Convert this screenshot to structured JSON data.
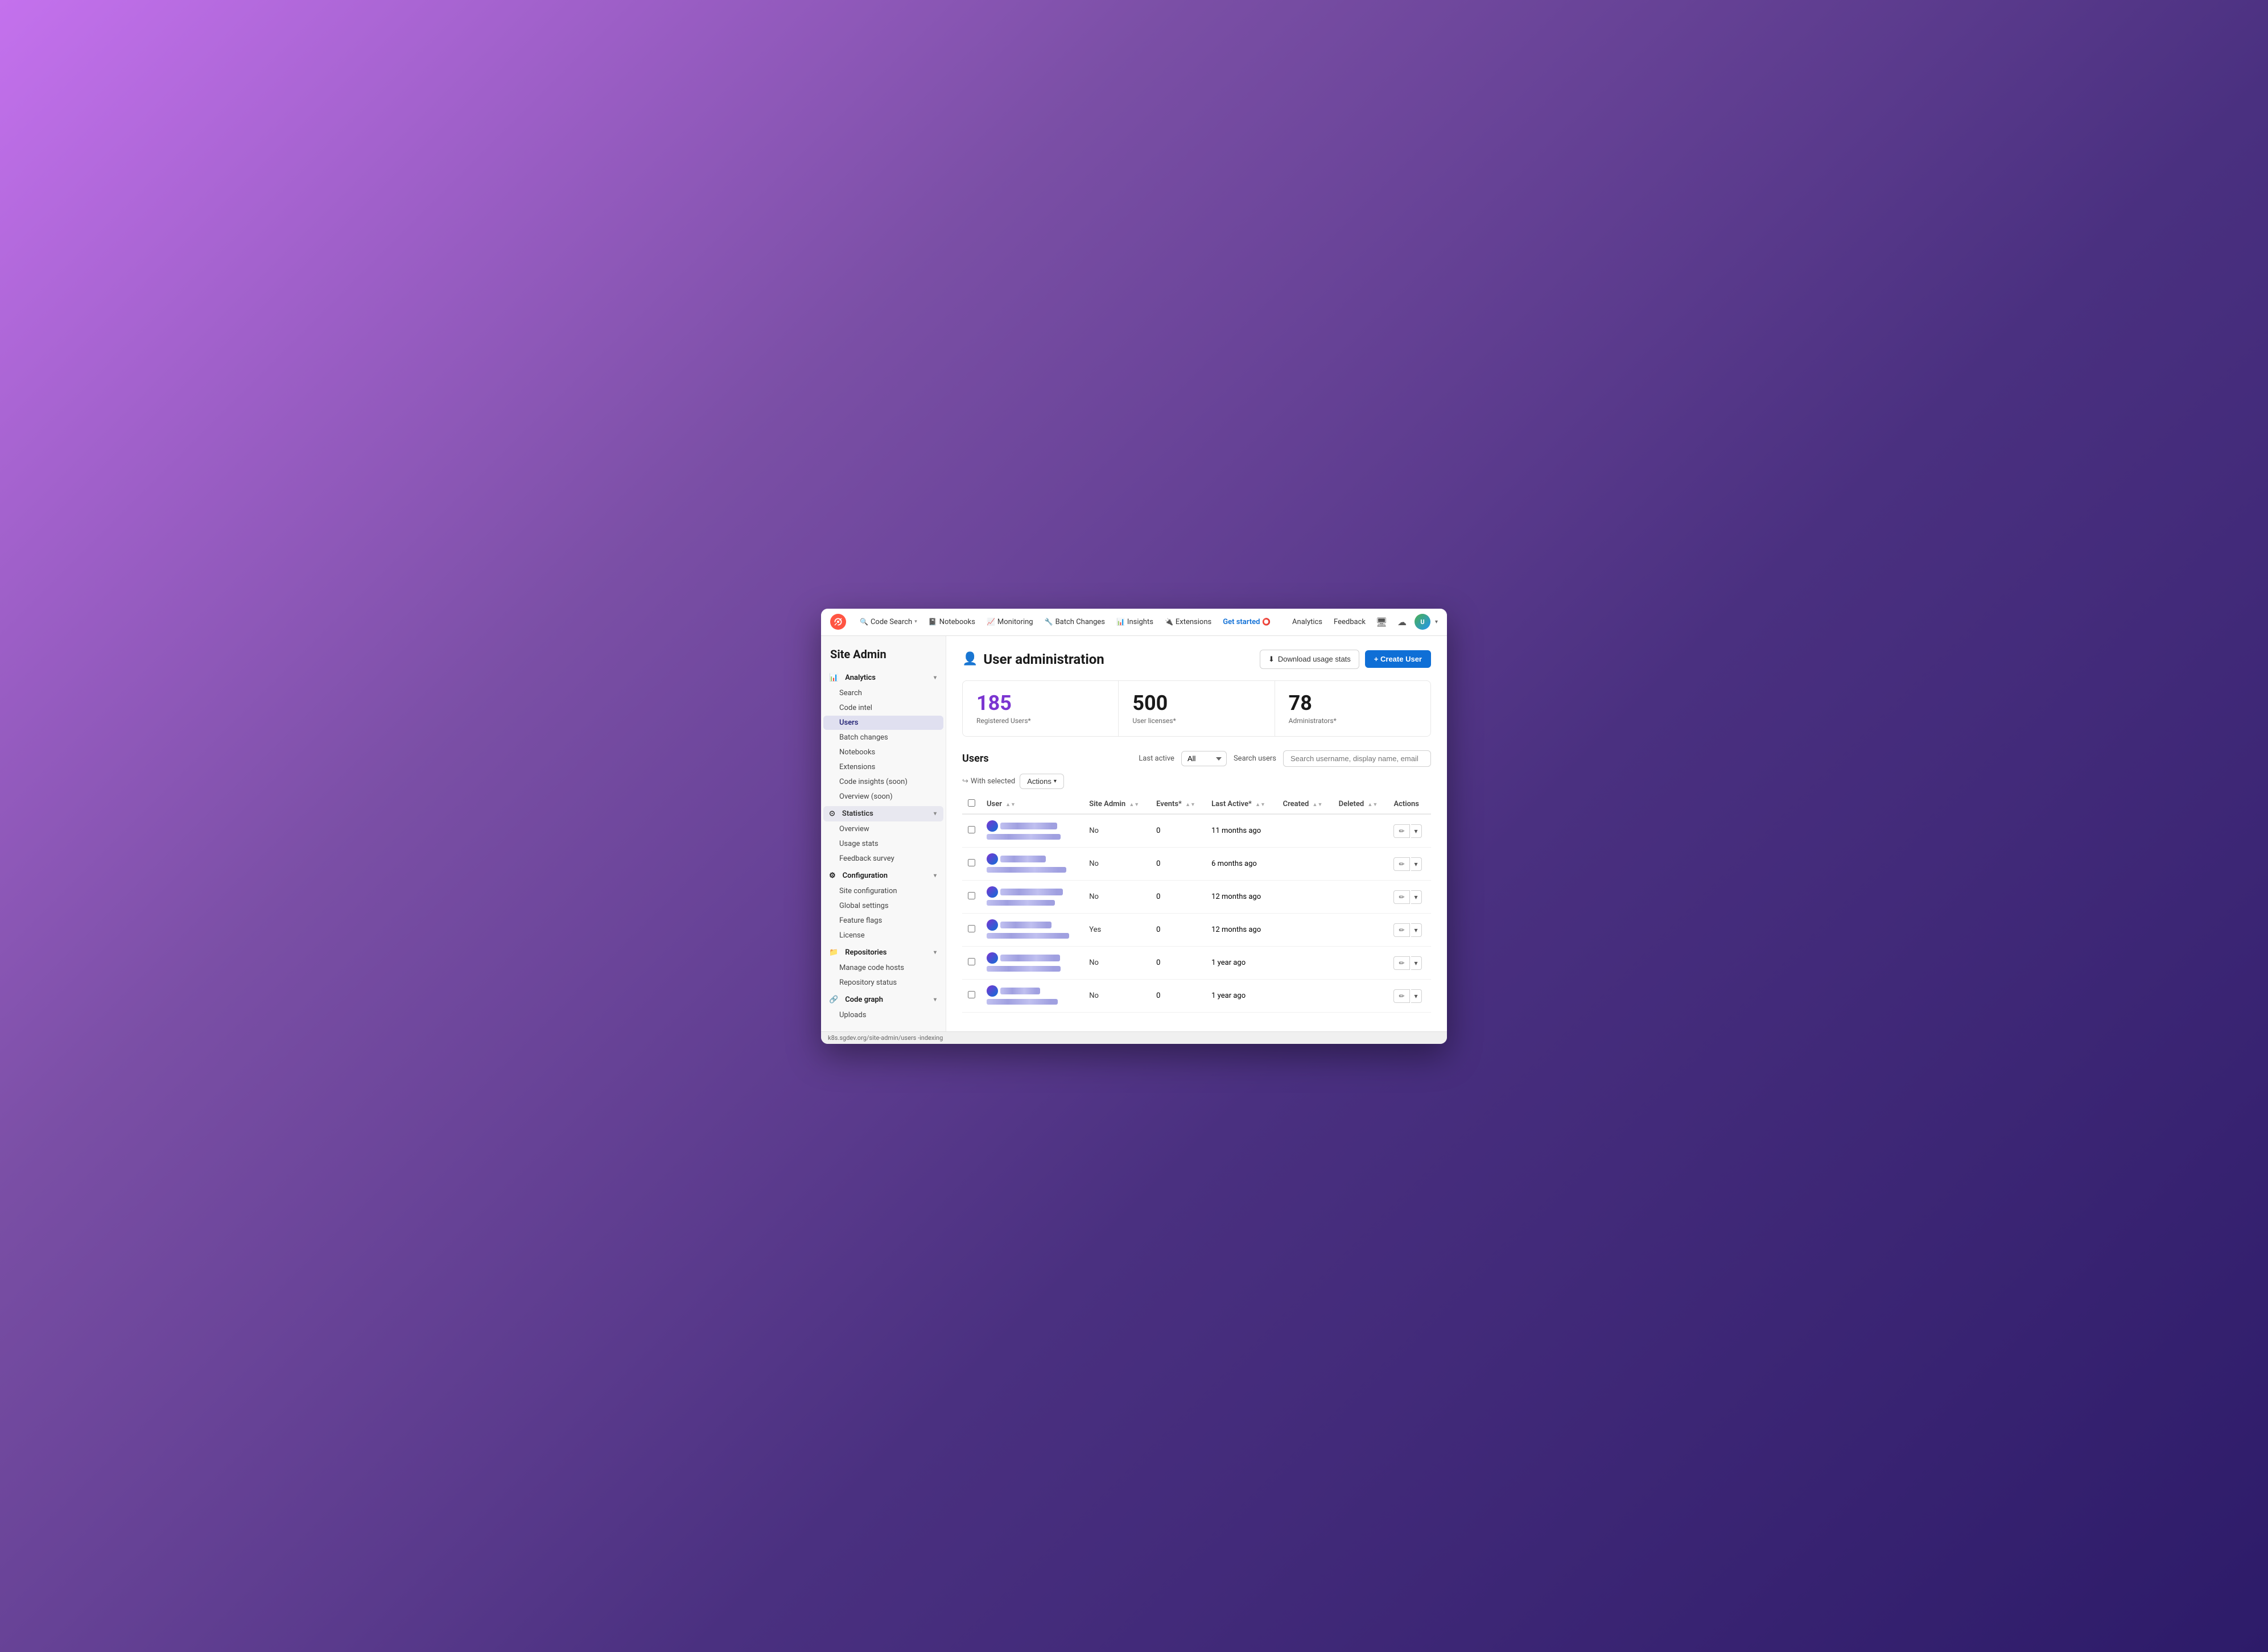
{
  "window": {
    "title": "Site Admin - User Administration"
  },
  "topnav": {
    "logo_label": "Sourcegraph",
    "items": [
      {
        "label": "Code Search",
        "icon": "🔍",
        "has_dropdown": true
      },
      {
        "label": "Notebooks",
        "icon": "📓",
        "has_dropdown": false
      },
      {
        "label": "Monitoring",
        "icon": "📈",
        "has_dropdown": false
      },
      {
        "label": "Batch Changes",
        "icon": "🔧",
        "has_dropdown": false
      },
      {
        "label": "Insights",
        "icon": "📊",
        "has_dropdown": false
      },
      {
        "label": "Extensions",
        "icon": "🔌",
        "has_dropdown": false
      },
      {
        "label": "Get started",
        "icon": "⭕",
        "has_dropdown": false,
        "class": "nav-get-started"
      }
    ],
    "right_items": [
      {
        "label": "Analytics"
      },
      {
        "label": "Feedback"
      }
    ]
  },
  "sidebar": {
    "site_admin_title": "Site Admin",
    "sections": [
      {
        "id": "analytics",
        "label": "Analytics",
        "icon": "📊",
        "active": false,
        "items": [
          {
            "label": "Search"
          },
          {
            "label": "Code intel"
          },
          {
            "label": "Users",
            "active": true
          },
          {
            "label": "Batch changes"
          },
          {
            "label": "Notebooks"
          },
          {
            "label": "Extensions"
          },
          {
            "label": "Code insights (soon)"
          },
          {
            "label": "Overview (soon)"
          }
        ]
      },
      {
        "id": "statistics",
        "label": "Statistics",
        "icon": "📈",
        "active": true,
        "items": [
          {
            "label": "Overview"
          },
          {
            "label": "Usage stats"
          },
          {
            "label": "Feedback survey"
          }
        ]
      },
      {
        "id": "configuration",
        "label": "Configuration",
        "icon": "⚙️",
        "active": false,
        "items": [
          {
            "label": "Site configuration"
          },
          {
            "label": "Global settings"
          },
          {
            "label": "Feature flags"
          },
          {
            "label": "License"
          }
        ]
      },
      {
        "id": "repositories",
        "label": "Repositories",
        "icon": "📁",
        "active": false,
        "items": [
          {
            "label": "Manage code hosts"
          },
          {
            "label": "Repository status"
          }
        ]
      },
      {
        "id": "code-graph",
        "label": "Code graph",
        "icon": "🔗",
        "active": false,
        "items": [
          {
            "label": "Uploads"
          }
        ]
      }
    ]
  },
  "page": {
    "title": "User administration",
    "title_icon": "👤",
    "download_btn": "Download usage stats",
    "create_btn": "+ Create User"
  },
  "stats": [
    {
      "number": "185",
      "label": "Registered Users*",
      "color": "purple"
    },
    {
      "number": "500",
      "label": "User licenses*",
      "color": "normal"
    },
    {
      "number": "78",
      "label": "Administrators*",
      "color": "normal"
    }
  ],
  "users_section": {
    "title": "Users",
    "last_active_label": "Last active",
    "last_active_value": "All",
    "search_label": "Search users",
    "search_placeholder": "Search username, display name, email",
    "with_selected_label": "With selected",
    "actions_btn": "Actions",
    "columns": [
      {
        "label": "User",
        "sortable": true
      },
      {
        "label": "Site Admin",
        "sortable": true
      },
      {
        "label": "Events*",
        "sortable": true
      },
      {
        "label": "Last Active*",
        "sortable": true
      },
      {
        "label": "Created",
        "sortable": true
      },
      {
        "label": "Deleted",
        "sortable": true
      },
      {
        "label": "Actions",
        "sortable": false
      }
    ],
    "rows": [
      {
        "name_blurred": true,
        "name_display": "user1",
        "email_display": "***@source...",
        "site_admin": "No",
        "events": "0",
        "last_active": "11 months ago",
        "created": "",
        "deleted": ""
      },
      {
        "name_blurred": true,
        "name_display": "user2",
        "email_display": "*@sourcegrap...",
        "site_admin": "No",
        "events": "0",
        "last_active": "6 months ago",
        "created": "",
        "deleted": ""
      },
      {
        "name_blurred": true,
        "name_display": "user3",
        "email_display": "***@sou...",
        "site_admin": "No",
        "events": "0",
        "last_active": "12 months ago",
        "created": "",
        "deleted": ""
      },
      {
        "name_blurred": true,
        "name_display": "user4",
        "email_display": "***@sourcegra...",
        "site_admin": "Yes",
        "events": "0",
        "last_active": "12 months ago",
        "created": "",
        "deleted": ""
      },
      {
        "name_blurred": true,
        "name_display": "user5",
        "email_display": "***@source...",
        "site_admin": "No",
        "events": "0",
        "last_active": "1 year ago",
        "created": "",
        "deleted": ""
      },
      {
        "name_blurred": true,
        "name_display": "user6",
        "email_display": "@source...",
        "site_admin": "No",
        "events": "0",
        "last_active": "1 year ago",
        "created": "",
        "deleted": ""
      }
    ]
  },
  "status_bar": {
    "url": "k8s.sgdev.org/site-admin/users",
    "suffix": "-indexing"
  }
}
